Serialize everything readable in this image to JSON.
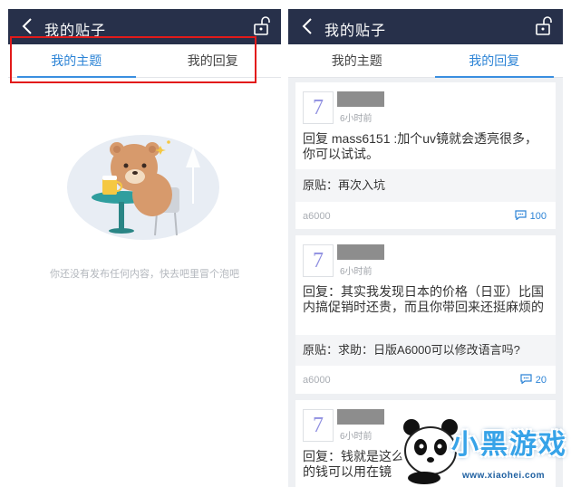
{
  "screens": {
    "left": {
      "title": "我的贴子",
      "tabs": [
        {
          "label": "我的主题",
          "active": true
        },
        {
          "label": "我的回复",
          "active": false
        }
      ],
      "empty_message": "你还没有发布任何内容，快去吧里冒个泡吧"
    },
    "right": {
      "title": "我的贴子",
      "tabs": [
        {
          "label": "我的主题",
          "active": false
        },
        {
          "label": "我的回复",
          "active": true
        }
      ],
      "posts": [
        {
          "time": "6小时前",
          "reply": "回复 mass6151 :加个uv镜就会透亮很多，你可以试试。",
          "original": "原贴：再次入坑",
          "forum": "a6000",
          "comment_count": "100"
        },
        {
          "time": "6小时前",
          "reply": "回复：其实我发现日本的价格（日亚）比国内搞促销时还贵，而且你带回来还挺麻烦的",
          "original": "原贴：求助：日版A6000可以修改语言吗?",
          "forum": "a6000",
          "comment_count": "20"
        },
        {
          "time": "6小时前",
          "reply": "回复：钱就是这么",
          "reply_line2": "的钱可以用在镜"
        }
      ]
    }
  },
  "watermark": {
    "title": "小黑游戏",
    "url": "www.xiaohei.com"
  },
  "colors": {
    "header": "#27304a",
    "accent": "#2d84d6",
    "highlight": "#e21a1a"
  }
}
